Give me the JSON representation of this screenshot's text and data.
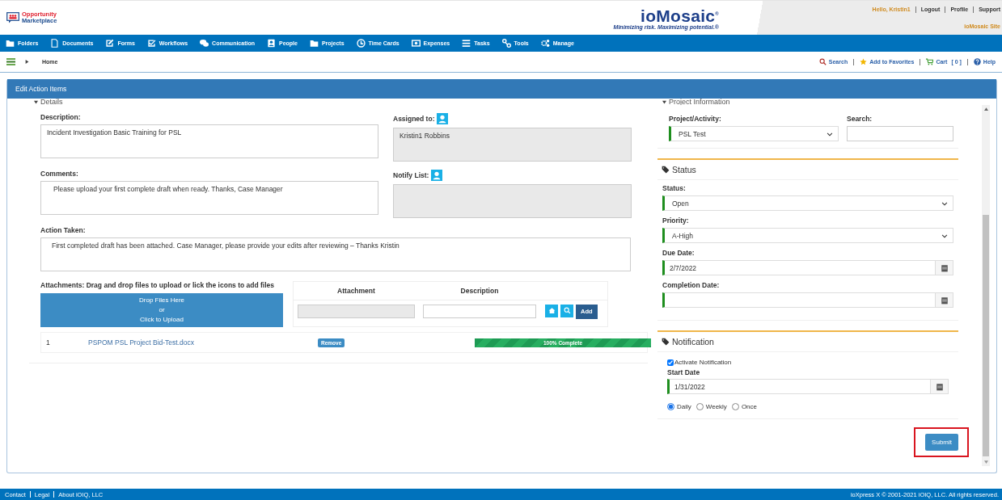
{
  "header": {
    "logo_lines": [
      "Opportunity",
      "Marketplace"
    ],
    "brand": "ioMosaic",
    "brand_mark": "®",
    "tagline": "Minimizing risk. Maximizing potential.®",
    "greeting": "Hello, Kristin1",
    "user_links": [
      "Logout",
      "Profile",
      "Support"
    ],
    "site_link": "ioMosaic Site"
  },
  "nav": [
    "Folders",
    "Documents",
    "Forms",
    "Workflows",
    "Communication",
    "People",
    "Projects",
    "Time Cards",
    "Expenses",
    "Tasks",
    "Tools",
    "Manage"
  ],
  "breadcrumb": "Home",
  "toolbar": {
    "search": "Search",
    "favorites": "Add to Favorites",
    "cart": "Cart",
    "cart_count": "[ 0 ]",
    "help": "Help"
  },
  "panel": {
    "title": "Edit Action Items"
  },
  "details": {
    "heading": "Details",
    "description_label": "Description:",
    "description": "Incident Investigation Basic Training for PSL",
    "assigned_label": "Assigned to:",
    "assigned": "Kristin1 Robbins",
    "comments_label": "Comments:",
    "comments": "Please upload your first complete draft when ready. Thanks, Case Manager",
    "notify_label": "Notify List:",
    "action_label": "Action Taken:",
    "action": "First completed draft has been attached.  Case Manager, please provide your edits after reviewing – Thanks Kristin"
  },
  "attachments": {
    "label": "Attachments: Drag and drop files to upload or lick the icons to add files",
    "drop_lines": [
      "Drop Files Here",
      "or",
      "Click to Upload"
    ],
    "columns": [
      "Attachment",
      "Description"
    ],
    "add": "Add",
    "files": [
      {
        "index": "1",
        "name": "PSPOM PSL Project Bid-Test.docx",
        "remove": "Remove",
        "level": 1,
        "progress": "100% Complete"
      }
    ]
  },
  "project": {
    "heading": "Project Information",
    "activity_label": "Project/Activity:",
    "activity": "PSL Test",
    "search_label": "Search:"
  },
  "status": {
    "title": "Status",
    "status_label": "Status:",
    "status": "Open",
    "priority_label": "Priority:",
    "priority": "A-High",
    "due_label": "Due Date:",
    "due": "2/7/2022",
    "completion_label": "Completion Date:"
  },
  "notification": {
    "title": "Notification",
    "activate": {
      "label": "Activate Notification",
      "checked": true
    },
    "start_label": "Start Date",
    "start": "1/31/2022",
    "frequency": [
      {
        "label": "Daily",
        "selected": true
      },
      {
        "label": "Weekly",
        "selected": false
      },
      {
        "label": "Once",
        "selected": false
      }
    ]
  },
  "submit": {
    "label": "Submit",
    "highlighted": true
  },
  "footer": {
    "links": [
      "Contact",
      "Legal",
      "About iOIQ, LLC"
    ],
    "copyright": "ioXpress X © 2001-2021 iOIQ, LLC. All rights reserved."
  }
}
